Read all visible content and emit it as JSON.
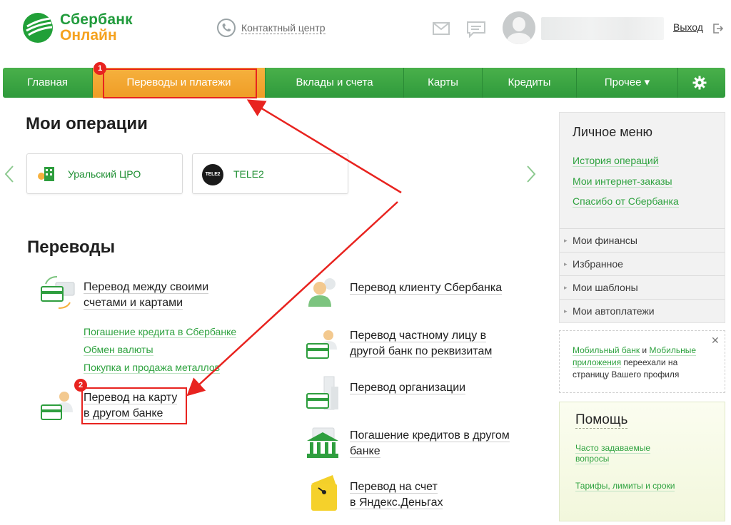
{
  "header": {
    "logo_line1": "Сбербанк",
    "logo_line2": "Онлайн",
    "contact_center": "Контактный центр",
    "logout": "Выход"
  },
  "nav": {
    "items": [
      {
        "label": "Главная"
      },
      {
        "label": "Переводы и платежи"
      },
      {
        "label": "Вклады и счета"
      },
      {
        "label": "Карты"
      },
      {
        "label": "Кредиты"
      },
      {
        "label": "Прочее ▾"
      }
    ],
    "settings_icon": "gear-icon"
  },
  "annotations": {
    "badge1": "1",
    "badge2": "2"
  },
  "my_operations": {
    "title": "Мои операции",
    "cards": [
      {
        "label": "Уральский ЦРО",
        "icon": "building-icon"
      },
      {
        "label": "TELE2",
        "icon_text": "TELE2"
      }
    ]
  },
  "transfers": {
    "title": "Переводы",
    "left": [
      {
        "line1": "Перевод между своими",
        "line2": "счетами и картами"
      },
      {
        "line1": "Перевод на карту",
        "line2": "в другом банке"
      }
    ],
    "sub_links": [
      "Погашение кредита в Сбербанке",
      "Обмен валюты",
      "Покупка и продажа металлов"
    ],
    "right": [
      {
        "line1": "Перевод клиенту Сбербанка",
        "line2": ""
      },
      {
        "line1": "Перевод частному лицу в",
        "line2": "другой банк по реквизитам"
      },
      {
        "line1": "Перевод организации",
        "line2": ""
      },
      {
        "line1": "Погашение кредитов в другом",
        "line2": "банке"
      },
      {
        "line1": "Перевод на счет",
        "line2": "в Яндекс.Деньгах"
      }
    ]
  },
  "personal_menu": {
    "title": "Личное меню",
    "links": [
      "История операций",
      "Мои интернет-заказы",
      "Спасибо от Сбербанка"
    ],
    "sections": [
      "Мои финансы",
      "Избранное",
      "Мои шаблоны",
      "Мои автоплатежи"
    ]
  },
  "notice": {
    "link1": "Мобильный банк",
    "conj": " и ",
    "link2": "Мобильные приложения",
    "rest": " переехали на страницу Вашего профиля",
    "close": "✕"
  },
  "help": {
    "title": "Помощь",
    "links": [
      "Часто задаваемые вопросы",
      "Тарифы, лимиты и сроки"
    ]
  },
  "colors": {
    "brand_green": "#2f9a3c",
    "accent_orange": "#f5a21f",
    "link_green": "#2ea23f",
    "annotation_red": "#e8231f"
  }
}
